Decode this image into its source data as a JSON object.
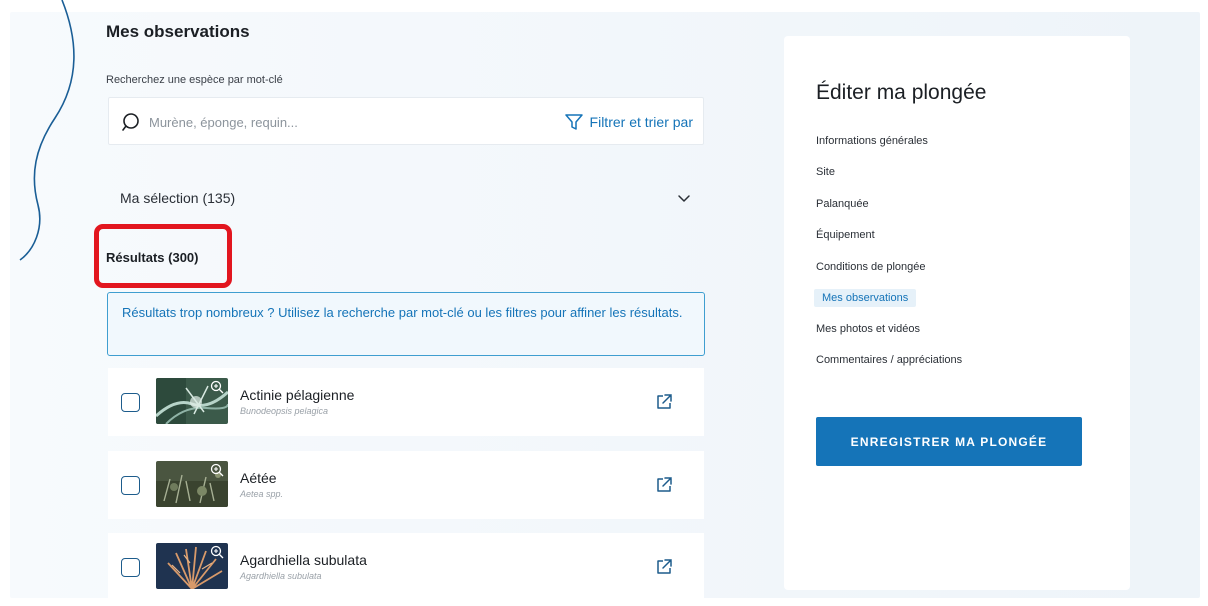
{
  "observations": {
    "title": "Mes observations",
    "search_label": "Recherchez une espèce par mot-clé",
    "search_placeholder": "Murène, éponge, requin...",
    "filter_label": "Filtrer et trier par",
    "selection_label": "Ma sélection (135)",
    "results_title": "Résultats (300)",
    "info_message": "Résultats trop nombreux ? Utilisez la recherche par mot-clé ou les filtres pour affiner les résultats.",
    "items": [
      {
        "name": "Actinie pélagienne",
        "latin": "Bunodeopsis pelagica",
        "checked": false
      },
      {
        "name": "Aétée",
        "latin": "Aetea spp.",
        "checked": false
      },
      {
        "name": "Agardhiella subulata",
        "latin": "Agardhiella subulata",
        "checked": false
      }
    ]
  },
  "sidebar": {
    "title": "Éditer ma plongée",
    "items": [
      {
        "label": "Informations générales"
      },
      {
        "label": "Site"
      },
      {
        "label": "Palanquée"
      },
      {
        "label": "Équipement"
      },
      {
        "label": "Conditions de plongée"
      },
      {
        "label": "Mes observations",
        "active": true
      },
      {
        "label": "Mes photos et vidéos"
      },
      {
        "label": "Commentaires / appréciations"
      }
    ],
    "save_label": "ENREGISTRER MA PLONGÉE"
  },
  "colors": {
    "accent": "#1574b8",
    "highlight": "#e2161f",
    "info_border": "#3f9ed0"
  },
  "icons": [
    "search-icon",
    "filter-icon",
    "chevron-down-icon",
    "zoom-icon",
    "external-link-icon"
  ]
}
